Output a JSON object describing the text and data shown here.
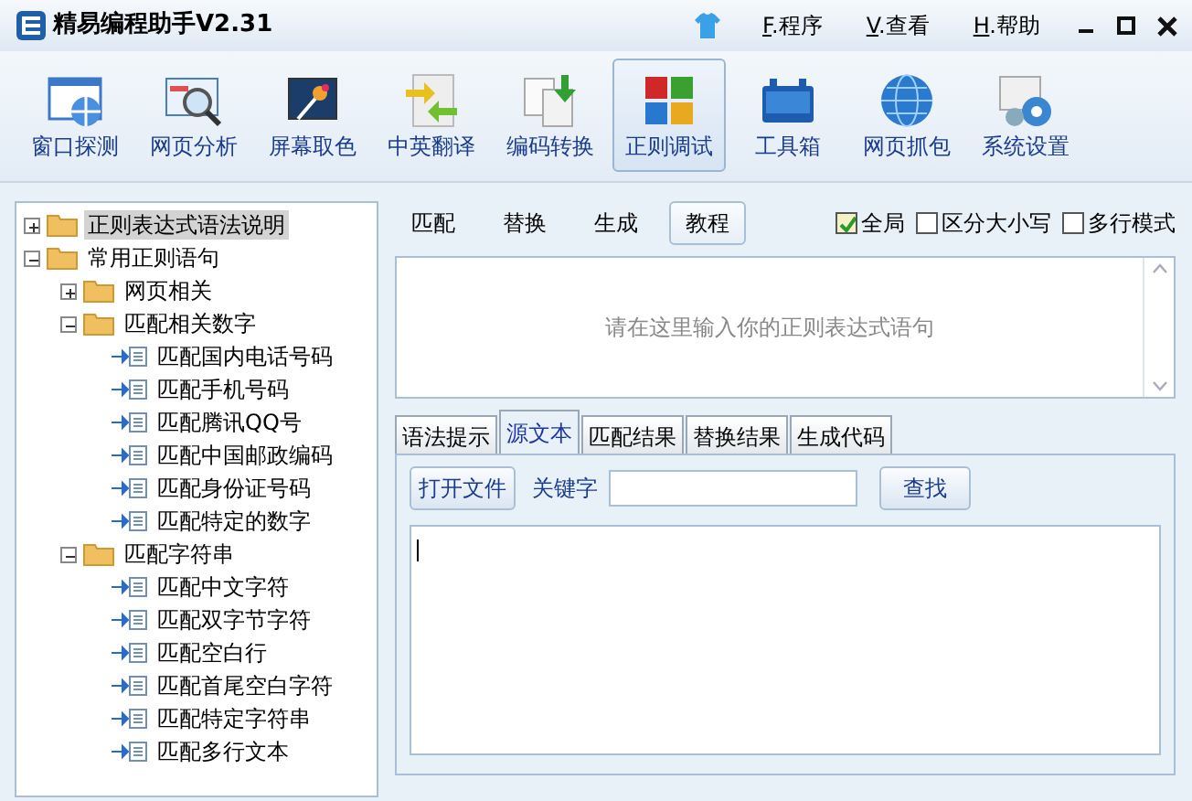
{
  "window": {
    "title": "精易编程助手V2.31",
    "menus": [
      "F.程序",
      "V.查看",
      "H.帮助"
    ]
  },
  "toolbar": [
    {
      "label": "窗口探测",
      "selected": false
    },
    {
      "label": "网页分析",
      "selected": false
    },
    {
      "label": "屏幕取色",
      "selected": false
    },
    {
      "label": "中英翻译",
      "selected": false
    },
    {
      "label": "编码转换",
      "selected": false
    },
    {
      "label": "正则调试",
      "selected": true
    },
    {
      "label": "工具箱",
      "selected": false
    },
    {
      "label": "网页抓包",
      "selected": false
    },
    {
      "label": "系统设置",
      "selected": false
    }
  ],
  "tree": [
    {
      "kind": "folder",
      "label": "正则表达式语法说明",
      "expanded": false,
      "selected": true
    },
    {
      "kind": "folder",
      "label": "常用正则语句",
      "expanded": true,
      "selected": false,
      "children": [
        {
          "kind": "folder",
          "label": "网页相关",
          "expanded": false,
          "selected": false
        },
        {
          "kind": "folder",
          "label": "匹配相关数字",
          "expanded": true,
          "selected": false,
          "children": [
            {
              "kind": "item",
              "label": "匹配国内电话号码",
              "selected": false
            },
            {
              "kind": "item",
              "label": "匹配手机号码",
              "selected": false
            },
            {
              "kind": "item",
              "label": "匹配腾讯QQ号",
              "selected": false
            },
            {
              "kind": "item",
              "label": "匹配中国邮政编码",
              "selected": false
            },
            {
              "kind": "item",
              "label": "匹配身份证号码",
              "selected": false
            },
            {
              "kind": "item",
              "label": "匹配特定的数字",
              "selected": false
            }
          ]
        },
        {
          "kind": "folder",
          "label": "匹配字符串",
          "expanded": true,
          "selected": false,
          "children": [
            {
              "kind": "item",
              "label": "匹配中文字符",
              "selected": false
            },
            {
              "kind": "item",
              "label": "匹配双字节字符",
              "selected": false
            },
            {
              "kind": "item",
              "label": "匹配空白行",
              "selected": false
            },
            {
              "kind": "item",
              "label": "匹配首尾空白字符",
              "selected": false
            },
            {
              "kind": "item",
              "label": "匹配特定字符串",
              "selected": false
            },
            {
              "kind": "item",
              "label": "匹配多行文本",
              "selected": false
            }
          ]
        }
      ]
    }
  ],
  "modes": [
    {
      "label": "匹配",
      "selected": false
    },
    {
      "label": "替换",
      "selected": false
    },
    {
      "label": "生成",
      "selected": false
    },
    {
      "label": "教程",
      "selected": true
    }
  ],
  "options": [
    {
      "label": "全局",
      "checked": true
    },
    {
      "label": "区分大小写",
      "checked": false
    },
    {
      "label": "多行模式",
      "checked": false
    }
  ],
  "regex_input": {
    "placeholder": "请在这里输入你的正则表达式语句"
  },
  "tabs": [
    {
      "label": "语法提示",
      "selected": false
    },
    {
      "label": "源文本",
      "selected": true
    },
    {
      "label": "匹配结果",
      "selected": false
    },
    {
      "label": "替换结果",
      "selected": false
    },
    {
      "label": "生成代码",
      "selected": false
    }
  ],
  "source": {
    "open_button": "打开文件",
    "keyword_label": "关键字",
    "find_button": "查找"
  }
}
